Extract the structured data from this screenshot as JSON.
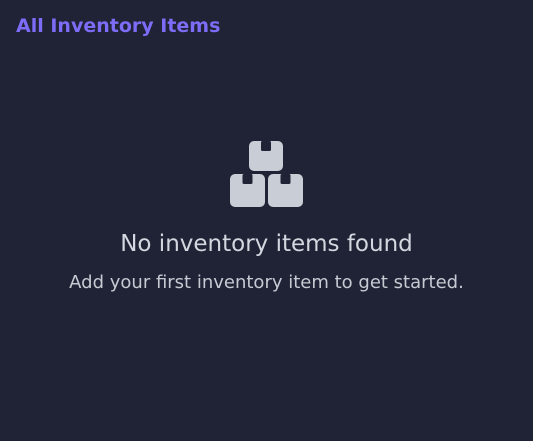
{
  "header": {
    "title": "All Inventory Items"
  },
  "empty_state": {
    "icon": "boxes-icon",
    "heading": "No inventory items found",
    "message": "Add your first inventory item to get started."
  },
  "colors": {
    "background": "#1f2335",
    "title": "#7c6cf6",
    "icon": "#c9cdd6",
    "heading": "#d4d7df",
    "message": "#c7cad3"
  }
}
